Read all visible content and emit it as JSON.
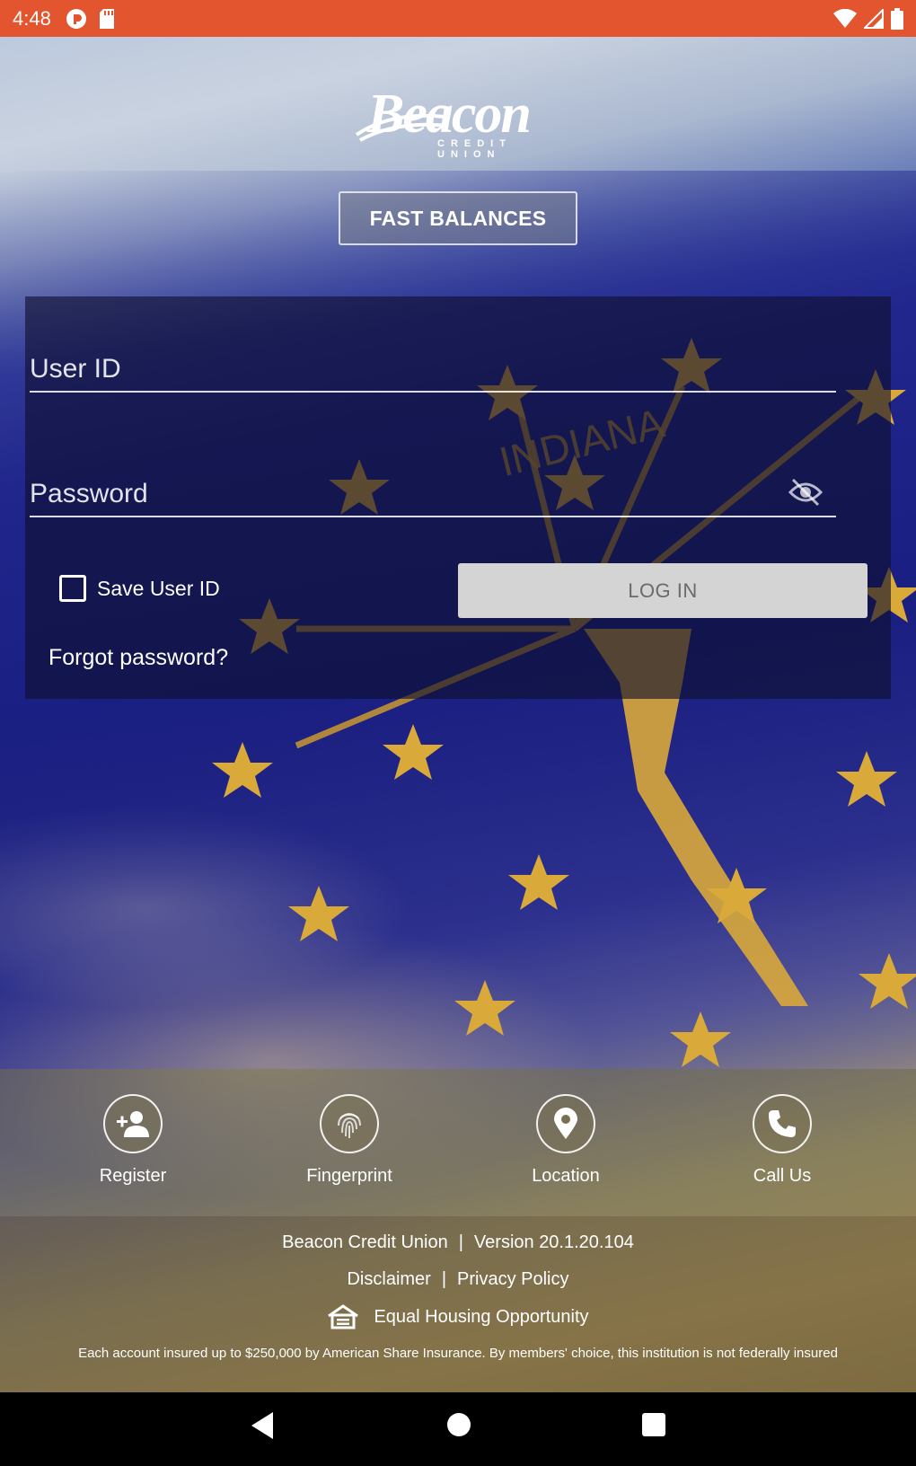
{
  "status_bar": {
    "time": "4:48",
    "left_icons": [
      "pocket-casts-icon",
      "sd-card-icon"
    ],
    "right_icons": [
      "wifi-icon",
      "signal-icon",
      "battery-icon"
    ],
    "color": "#e2552f"
  },
  "logo": {
    "word": "Beacon",
    "subtitle": "CREDIT UNION"
  },
  "fast_balances": {
    "label": "FAST BALANCES"
  },
  "login": {
    "user_id_placeholder": "User ID",
    "user_id_value": "",
    "password_placeholder": "Password",
    "password_value": "",
    "password_toggle_icon": "eye-off-icon",
    "save_user_id_label": "Save User ID",
    "save_user_id_checked": false,
    "login_label": "LOG IN",
    "forgot_label": "Forgot password?"
  },
  "actions": [
    {
      "label": "Register",
      "icon": "person-add-icon"
    },
    {
      "label": "Fingerprint",
      "icon": "fingerprint-icon"
    },
    {
      "label": "Location",
      "icon": "location-pin-icon"
    },
    {
      "label": "Call Us",
      "icon": "phone-icon"
    }
  ],
  "footer": {
    "org_name": "Beacon Credit Union",
    "version": "Version 20.1.20.104",
    "disclaimer": "Disclaimer",
    "privacy": "Privacy Policy",
    "equal_housing": "Equal Housing Opportunity",
    "equal_housing_icon": "equal-housing-icon",
    "insured_text": "Each account insured up to $250,000 by American Share Insurance. By members' choice, this institution is not federally insured",
    "separator": "|"
  },
  "nav_bar": {
    "icons": [
      "back-icon",
      "home-icon",
      "recents-icon"
    ]
  },
  "colors": {
    "flag_blue": "#1d2280",
    "flag_gold": "#d9a93a",
    "login_button_bg": "#d4d4d4"
  }
}
